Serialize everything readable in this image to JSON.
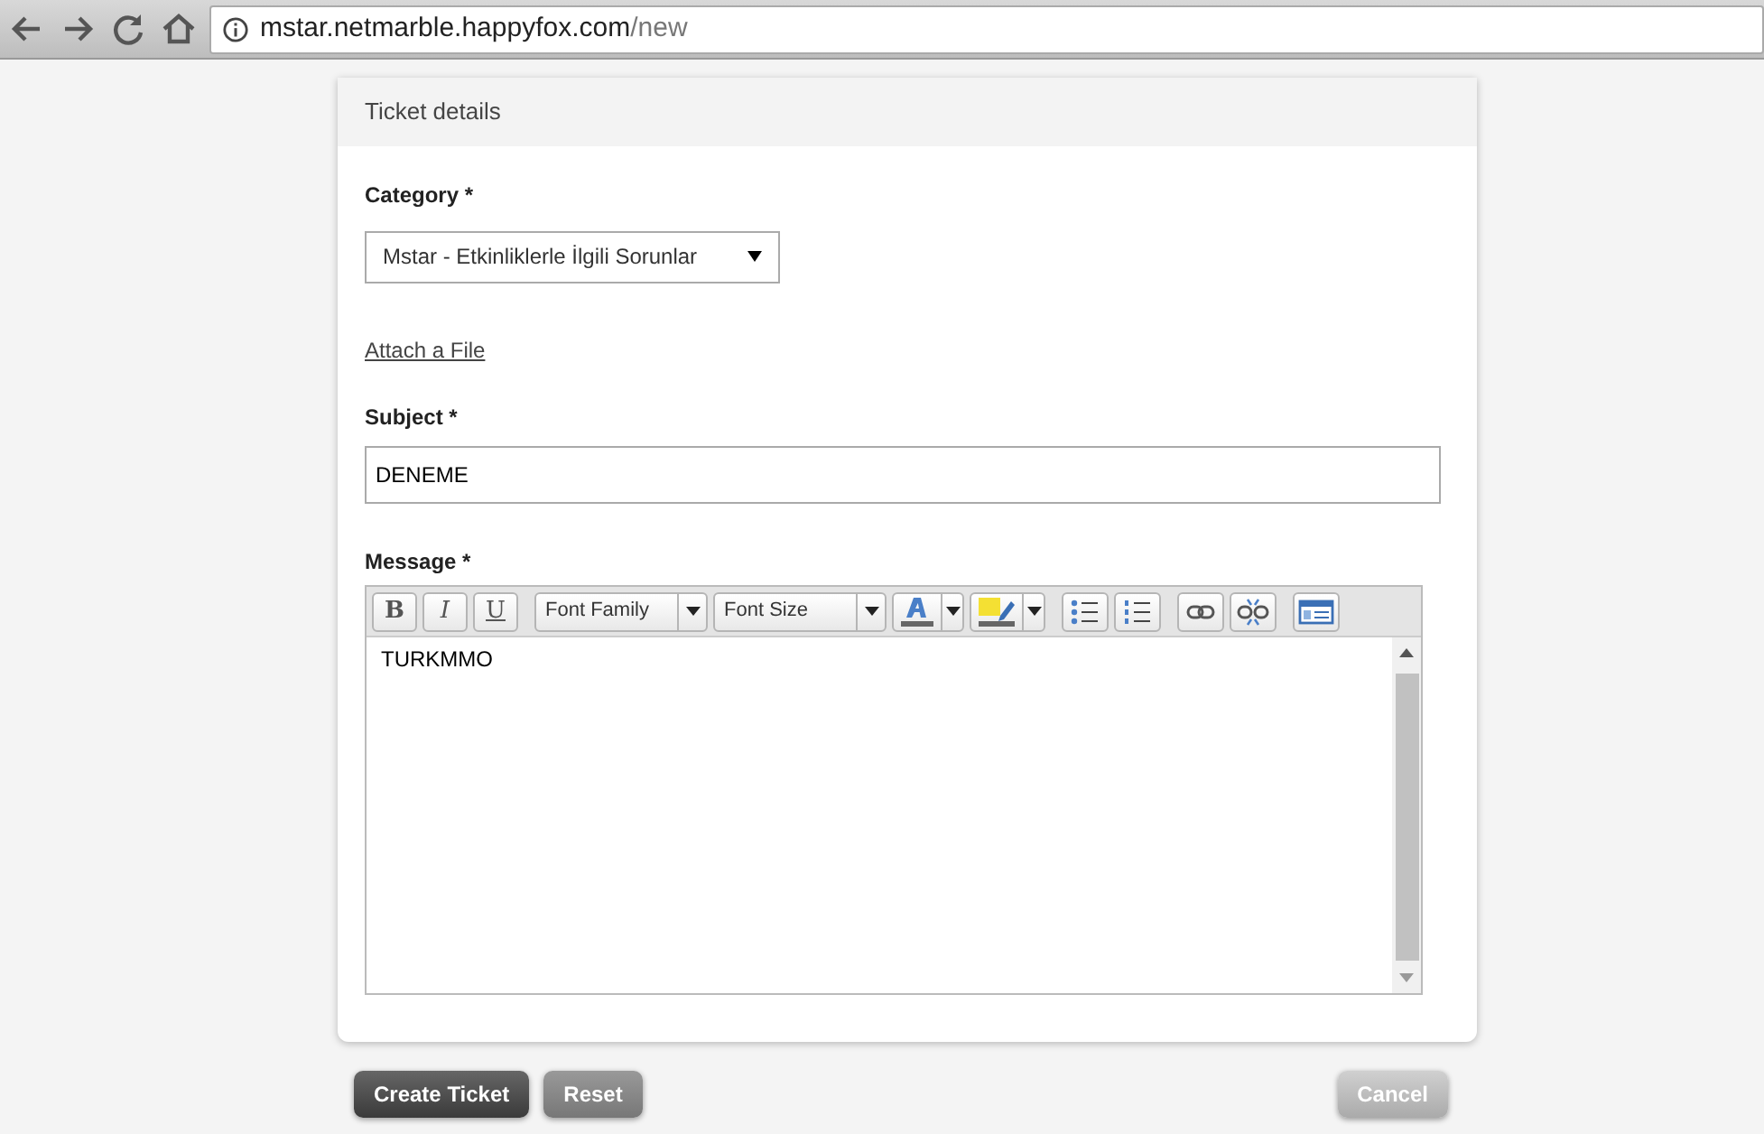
{
  "browser": {
    "url_host": "mstar.netmarble.happyfox.com",
    "url_path": "/new"
  },
  "panel": {
    "title": "Ticket details"
  },
  "category": {
    "label": "Category",
    "required": "*",
    "value": "Mstar - Etkinliklerle İlgili Sorunlar"
  },
  "attach_link": "Attach a File",
  "subject": {
    "label": "Subject",
    "required": "*",
    "value": "DENEME"
  },
  "message": {
    "label": "Message",
    "required": "*",
    "value": "TURKMMO",
    "toolbar": [
      {
        "kind": "text",
        "label": "B"
      },
      {
        "kind": "text",
        "label": "I"
      },
      {
        "kind": "text",
        "label": "U"
      },
      {
        "kind": "select",
        "label": "Font Family"
      },
      {
        "kind": "select",
        "label": "Font Size"
      },
      {
        "kind": "split"
      },
      {
        "kind": "split"
      },
      {
        "kind": "icon"
      },
      {
        "kind": "icon"
      },
      {
        "kind": "icon"
      },
      {
        "kind": "icon"
      },
      {
        "kind": "icon"
      }
    ]
  },
  "buttons": [
    {
      "label": "Create Ticket",
      "kind": "primary"
    },
    {
      "label": "Reset",
      "kind": "secondary"
    },
    {
      "label": "Cancel",
      "kind": "muted"
    }
  ]
}
